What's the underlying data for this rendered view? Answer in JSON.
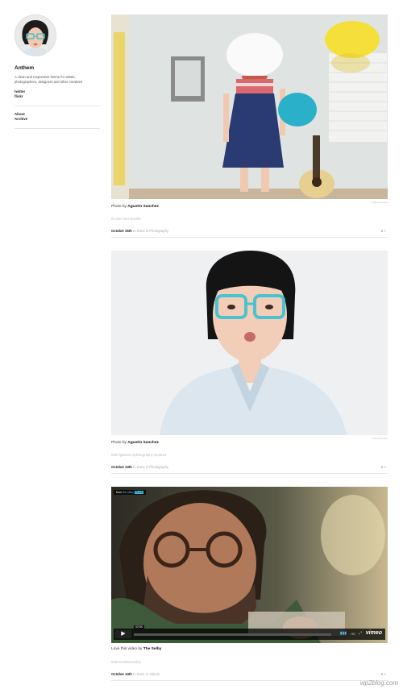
{
  "sidebar": {
    "title": "Anthem",
    "description": "A clean and responsive theme for artists, photographers, designers and other creatives",
    "social": [
      "twitter",
      "flickr"
    ],
    "nav": [
      "About",
      "Archive"
    ]
  },
  "posts": [
    {
      "credit": "Flight Hat Label",
      "caption_prefix": "Photo by",
      "caption_author": "Agustin Sanchez",
      "tags": "#colors #art #profile",
      "date": "October 25th",
      "category": "In Done in Photography",
      "comments": "0"
    },
    {
      "credit": "Flight Hat Label",
      "caption_prefix": "Photo by",
      "caption_author": "Agustin Sanchez",
      "tags": "#art #glasses #photography #portrait",
      "date": "October 24th",
      "category": "In Done in Photography",
      "comments": "0"
    },
    {
      "caption_prefix": "Love this video by",
      "caption_author": "The Selby",
      "tags": "#art #craftsmanship",
      "date": "October 24th",
      "category": "In Done in Videos",
      "comments": "0",
      "video": {
        "badge_from": "from",
        "badge_source": "the selby",
        "badge_extra": "PLUS",
        "time": "02:04",
        "hd": "HD",
        "brand": "vimeo"
      }
    }
  ],
  "watermark": "wp2blog.com"
}
